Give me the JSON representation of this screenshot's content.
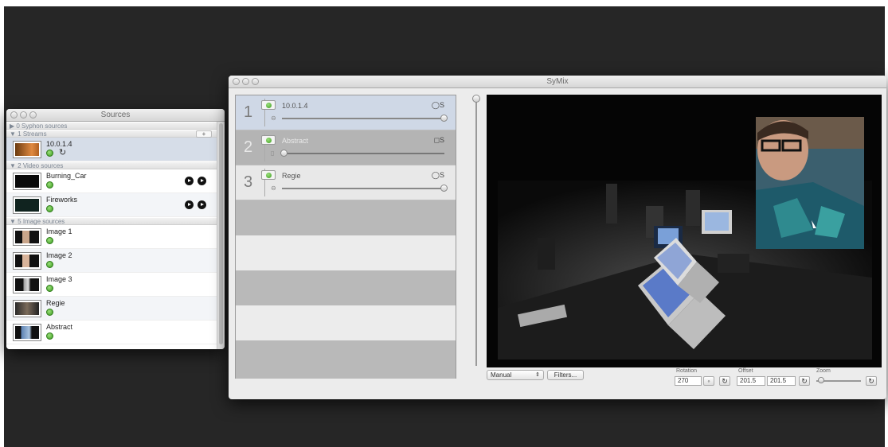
{
  "sources_window": {
    "title": "Sources",
    "groups": [
      {
        "label": "▶ 0 Syphon sources"
      },
      {
        "label": "▼ 1 Streams",
        "add_label": "+"
      },
      {
        "label": "▼ 2 Video sources"
      },
      {
        "label": "▼ 5 Image sources"
      }
    ],
    "stream_items": [
      {
        "name": "10.0.1.4",
        "refresh_icon": "refresh-icon"
      }
    ],
    "video_items": [
      {
        "name": "Burning_Car"
      },
      {
        "name": "Fireworks"
      }
    ],
    "image_items": [
      {
        "name": "Image 1"
      },
      {
        "name": "Image 2"
      },
      {
        "name": "Image 3"
      },
      {
        "name": "Regie"
      },
      {
        "name": "Abstract"
      }
    ]
  },
  "symix_window": {
    "title": "SyMix",
    "channels": [
      {
        "number": "1",
        "label": "10.0.1.4",
        "solo": "S",
        "level": 1.0
      },
      {
        "number": "2",
        "label": "Abstract",
        "solo": "S",
        "level": 0.0
      },
      {
        "number": "3",
        "label": "Regie",
        "solo": "S",
        "level": 1.0
      }
    ],
    "mode_select": {
      "value": "Manual"
    },
    "filters_button": "Filters...",
    "rotation": {
      "label": "Rotation",
      "value": "270"
    },
    "offset": {
      "label": "Offset",
      "x": "201.5",
      "y": "201.5"
    },
    "zoom": {
      "label": "Zoom"
    }
  },
  "colors": {
    "desktop": "#262626",
    "active_led": "#3a9a1f",
    "selected_row": "#d6dde8"
  }
}
